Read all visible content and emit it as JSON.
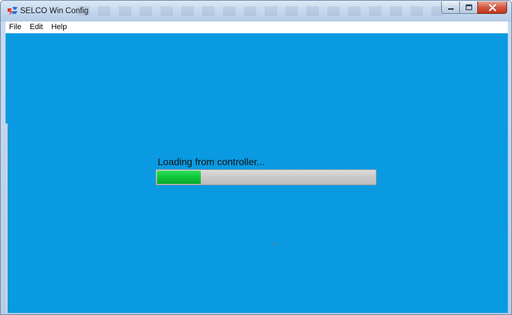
{
  "window": {
    "title": "SELCO Win Config",
    "controls": {
      "minimize": "minimize",
      "maximize": "maximize",
      "close": "close"
    }
  },
  "menu": {
    "items": [
      {
        "label": "File"
      },
      {
        "label": "Edit"
      },
      {
        "label": "Help"
      }
    ]
  },
  "loading": {
    "label": "Loading from controller...",
    "progress_percent": 20
  },
  "colors": {
    "client_background": "#0a9ae2",
    "progress_fill": "#0fc93a",
    "progress_track": "#c8c8c8"
  },
  "icons": {
    "app": "selco-app-icon",
    "minimize": "minimize-icon",
    "maximize": "maximize-icon",
    "close": "close-icon"
  }
}
